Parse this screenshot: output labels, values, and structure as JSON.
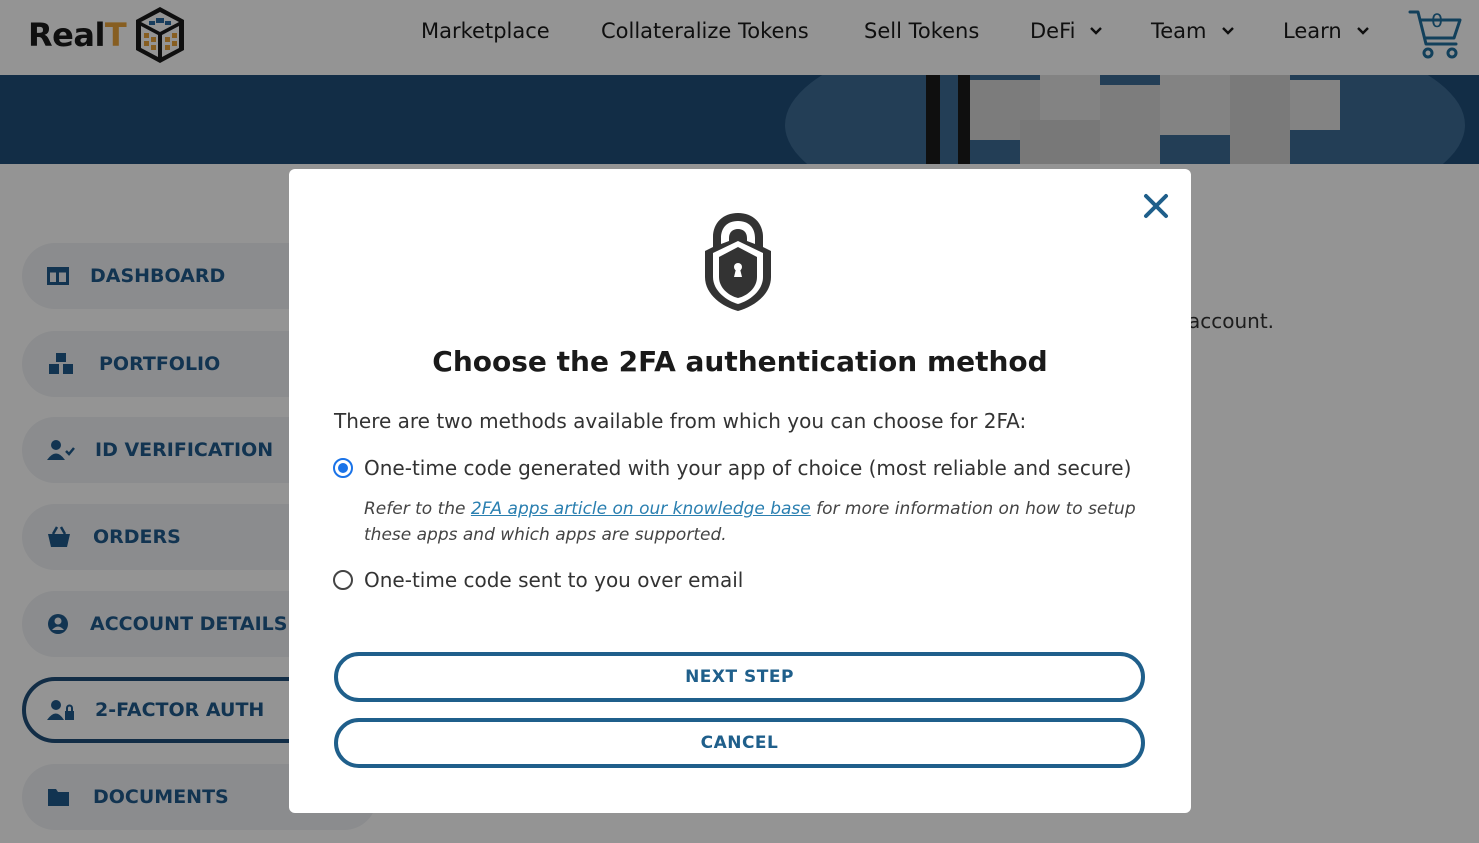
{
  "header": {
    "logo_text_main": "Real",
    "logo_text_accent": "T",
    "nav": [
      {
        "label": "Marketplace",
        "has_dropdown": false
      },
      {
        "label": "Collateralize Tokens",
        "has_dropdown": false
      },
      {
        "label": "Sell Tokens",
        "has_dropdown": false
      },
      {
        "label": "DeFi",
        "has_dropdown": true
      },
      {
        "label": "Team",
        "has_dropdown": true
      },
      {
        "label": "Learn",
        "has_dropdown": true
      }
    ],
    "cart_count": "0",
    "cart_icon": "cart-icon"
  },
  "sidebar": {
    "items": [
      {
        "label": "DASHBOARD",
        "icon": "dashboard-icon",
        "active": false
      },
      {
        "label": "PORTFOLIO",
        "icon": "portfolio-icon",
        "active": false
      },
      {
        "label": "ID VERIFICATION",
        "icon": "id-verification-icon",
        "active": false
      },
      {
        "label": "ORDERS",
        "icon": "basket-icon",
        "active": false
      },
      {
        "label": "ACCOUNT DETAILS",
        "icon": "account-icon",
        "active": false
      },
      {
        "label": "2-FACTOR AUTH",
        "icon": "user-lock-icon",
        "active": true
      },
      {
        "label": "DOCUMENTS",
        "icon": "folder-icon",
        "active": false
      }
    ]
  },
  "main": {
    "background_text": "account."
  },
  "modal": {
    "title": "Choose the 2FA authentication method",
    "intro": "There are two methods available from which you can choose for 2FA:",
    "options": [
      {
        "label": "One-time code generated with your app of choice (most reliable and secure)",
        "selected": true
      },
      {
        "label": "One-time code sent to you over email",
        "selected": false
      }
    ],
    "note_prefix": "Refer to the ",
    "note_link": "2FA apps article on our knowledge base",
    "note_suffix": " for more information on how to setup these apps and which apps are supported.",
    "next_label": "NEXT STEP",
    "cancel_label": "CANCEL"
  },
  "colors": {
    "brand_blue": "#1f4e79",
    "accent_orange": "#e8a23a",
    "button_blue": "#1f5f8b",
    "radio_blue": "#1a73e8"
  }
}
